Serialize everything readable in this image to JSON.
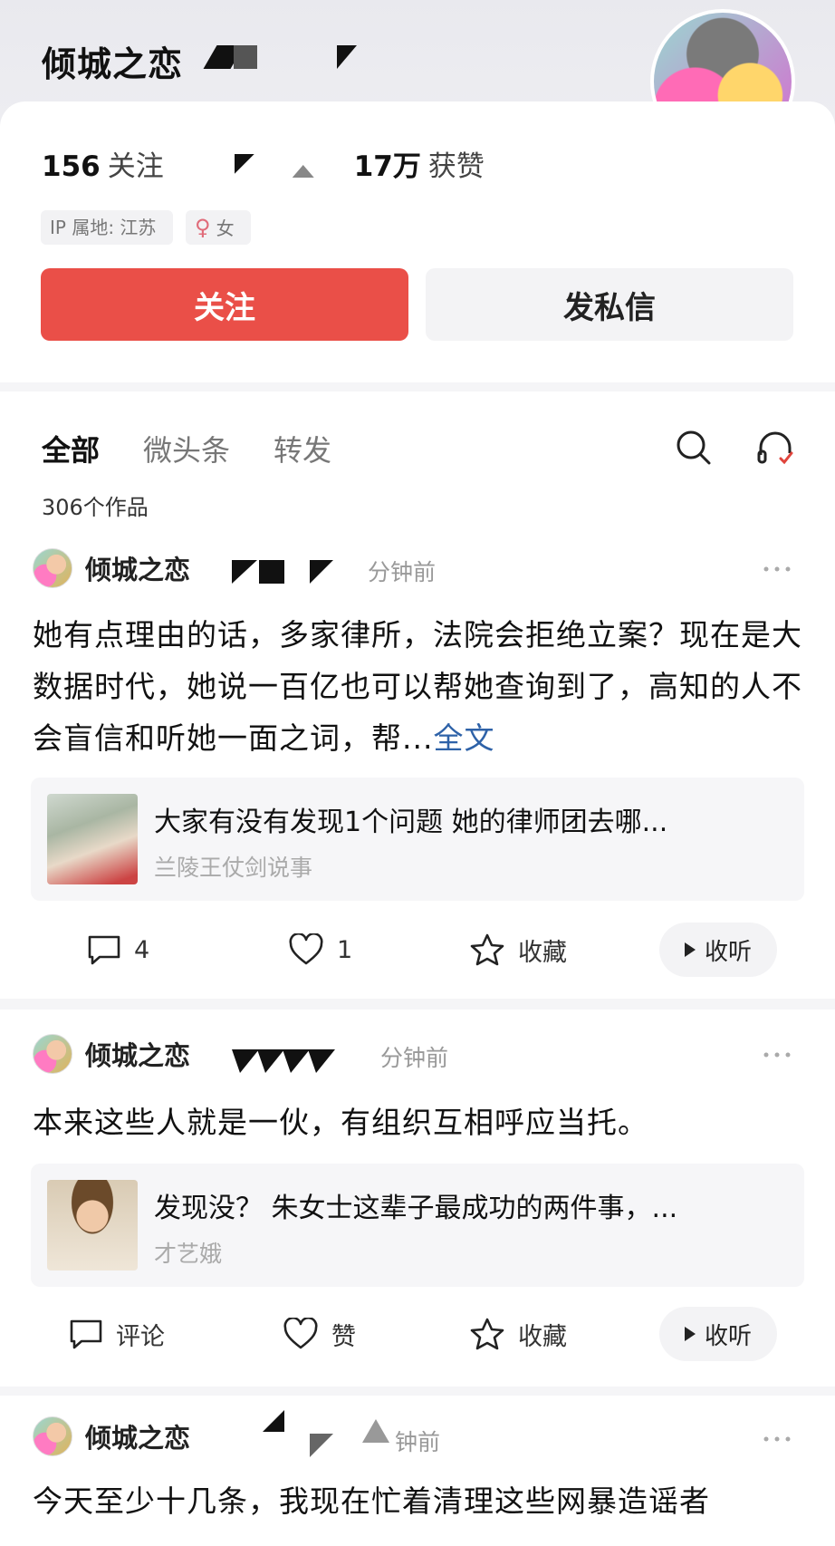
{
  "profile": {
    "name": "倾城之恋",
    "stats": [
      {
        "num": "156",
        "label": "关注"
      },
      {
        "num": "17万",
        "label": "获赞"
      }
    ],
    "ip_tag": "IP 属地: 江苏",
    "gender_symbol": "♀",
    "gender_tag": "女",
    "follow_label": "关注",
    "message_label": "发私信"
  },
  "tabs": {
    "items": [
      "全部",
      "微头条",
      "转发"
    ],
    "works_count": "306个作品"
  },
  "posts": [
    {
      "author": "倾城之恋",
      "time": "分钟前",
      "text": "她有点理由的话，多家律所，法院会拒绝立案？现在是大数据时代，她说一百亿也可以帮她查询到了，高知的人不会盲信和听她一面之词，帮...",
      "fulltext": "全文",
      "link_title": "大家有没有发现1个问题 她的律师团去哪...",
      "link_source": "兰陵王仗剑说事",
      "comment": "4",
      "like": "1",
      "collect": "收藏",
      "listen": "收听"
    },
    {
      "author": "倾城之恋",
      "time": "分钟前",
      "text": "本来这些人就是一伙，有组织互相呼应当托。",
      "link_title": "发现没？ 朱女士这辈子最成功的两件事，...",
      "link_source": "才艺娥",
      "comment": "评论",
      "like": "赞",
      "collect": "收藏",
      "listen": "收听"
    },
    {
      "author": "倾城之恋",
      "time": "钟前",
      "text": "今天至少十几条，我现在忙着清理这些网暴造谣者"
    }
  ]
}
